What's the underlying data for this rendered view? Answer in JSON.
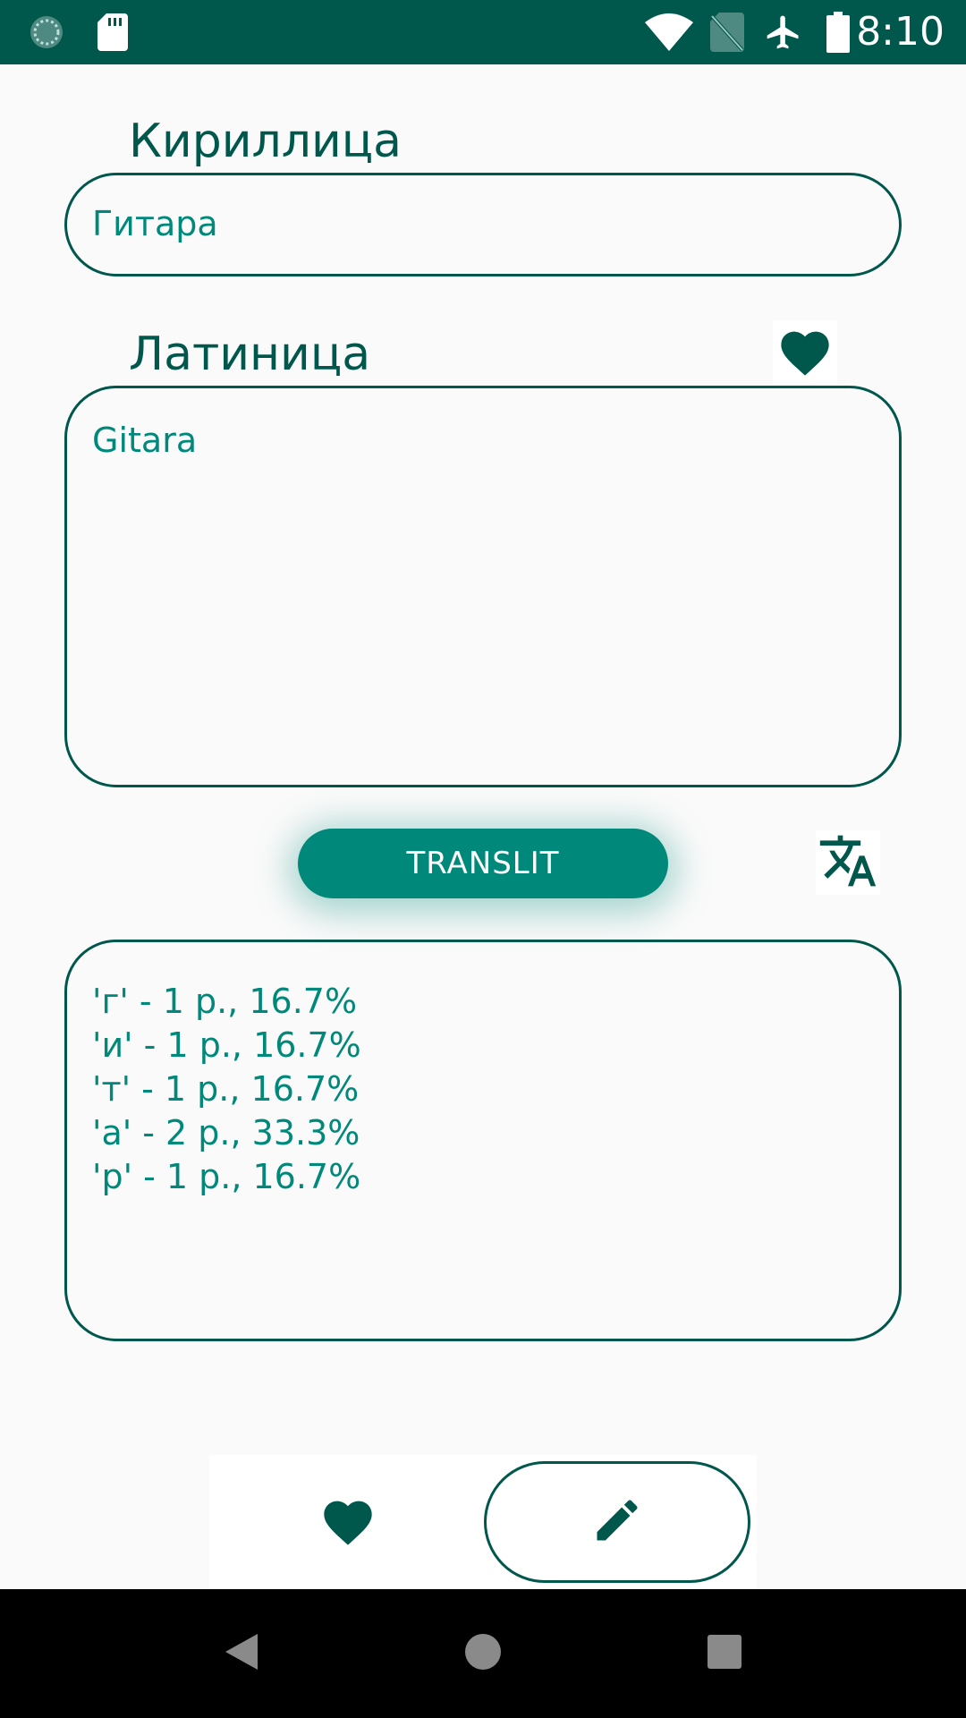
{
  "status_bar": {
    "time": "8:10",
    "icons": [
      "sync-icon",
      "sd-card-icon",
      "wifi-icon",
      "no-sim-icon",
      "airplane-mode-icon",
      "battery-icon"
    ]
  },
  "cyrillic": {
    "label": "Кириллица",
    "value": "Гитара"
  },
  "latin": {
    "label": "Латиница",
    "value": "Gitara",
    "favorite_icon": "heart-icon"
  },
  "translit_button": {
    "label": "TRANSLIT"
  },
  "translate_icon": "translate-icon",
  "stats": {
    "lines": [
      "'г' - 1 р., 16.7%",
      "'и' - 1 р., 16.7%",
      "'т' - 1 р., 16.7%",
      "'а' - 2 р., 33.3%",
      "'р' - 1 р., 16.7%"
    ]
  },
  "bottom_nav": {
    "items": [
      {
        "icon": "heart-icon",
        "selected": false
      },
      {
        "icon": "pencil-icon",
        "selected": true
      }
    ]
  },
  "system_nav": {
    "icons": [
      "back-icon",
      "home-icon",
      "recents-icon"
    ]
  },
  "colors": {
    "primary_dark": "#00574b",
    "accent": "#00897b",
    "background": "#fafafa"
  }
}
